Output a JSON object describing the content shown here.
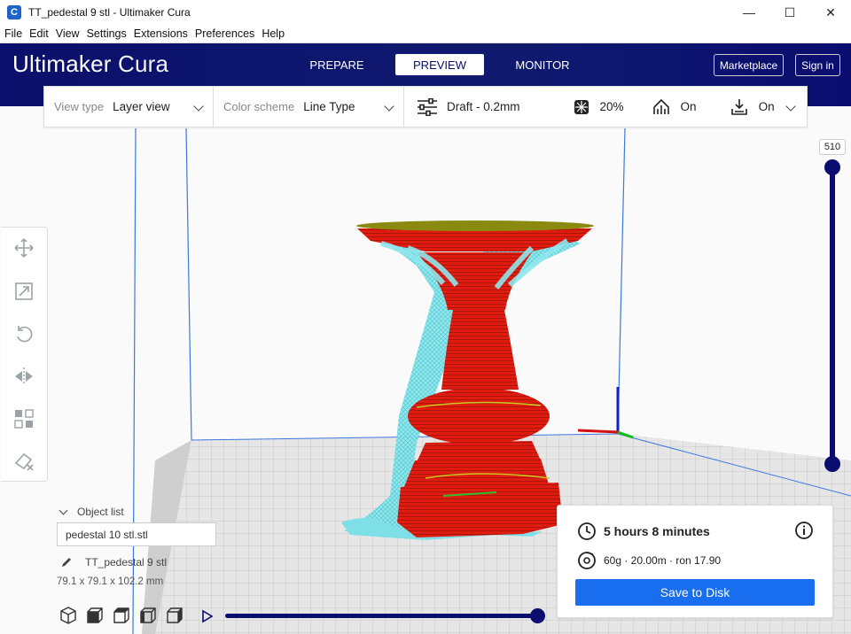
{
  "window": {
    "title": "TT_pedestal 9 stl - Ultimaker Cura",
    "app_icon": "C",
    "controls": [
      "—",
      "☐",
      "✕"
    ]
  },
  "menu": [
    "File",
    "Edit",
    "View",
    "Settings",
    "Extensions",
    "Preferences",
    "Help"
  ],
  "header": {
    "logo_bold": "Ultimaker",
    "logo_light": "Cura",
    "tabs": [
      {
        "label": "PREPARE",
        "active": false
      },
      {
        "label": "PREVIEW",
        "active": true
      },
      {
        "label": "MONITOR",
        "active": false
      }
    ],
    "marketplace_label": "Marketplace",
    "signin_label": "Sign in",
    "color": "#0a0d6e"
  },
  "viewbar": {
    "view_type_label": "View type",
    "view_type_value": "Layer view",
    "color_scheme_label": "Color scheme",
    "color_scheme_value": "Line Type",
    "profile": "Draft - 0.2mm",
    "infill": "20%",
    "support": "On",
    "adhesion": "On"
  },
  "tools": [
    "move-icon",
    "scale-icon",
    "rotate-icon",
    "mirror-icon",
    "per-model-settings-icon",
    "support-blocker-icon"
  ],
  "layer_slider": {
    "current_layer": "510",
    "level": 1.0
  },
  "object_list": {
    "header": "Object list",
    "file": "pedestal 10 stl.stl",
    "object_name": "TT_pedestal 9 stl",
    "dimensions": "79.1 x 79.1 x 102.2 mm"
  },
  "camera_views": [
    "3d-view-icon",
    "front-view-icon",
    "top-view-icon",
    "left-view-icon",
    "right-view-icon"
  ],
  "simulation": {
    "progress": 1.0
  },
  "print_info": {
    "time": "5 hours 8 minutes",
    "material": "60g · 20.00m · ron 17.90",
    "save_label": "Save to Disk",
    "button_color": "#196ef0"
  }
}
